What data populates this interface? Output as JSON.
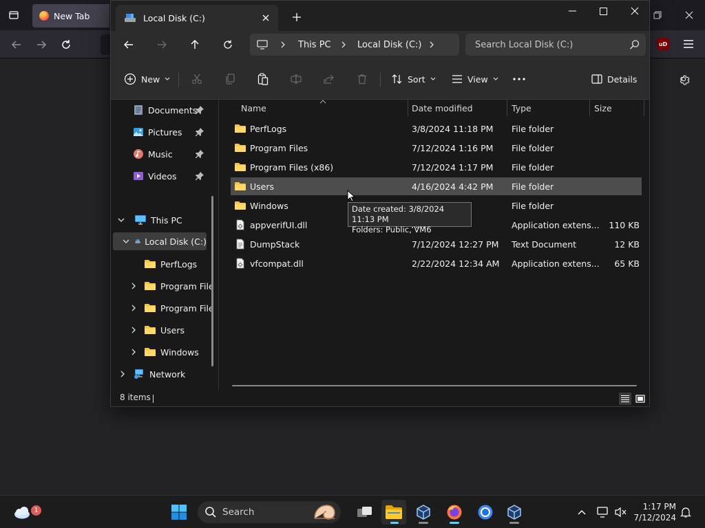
{
  "browser": {
    "tab_title": "New Tab",
    "ext_badge": "uD"
  },
  "explorer": {
    "tab_title": "Local Disk (C:)",
    "breadcrumb": [
      "This PC",
      "Local Disk (C:)"
    ],
    "search_placeholder": "Search Local Disk (C:)",
    "commands": {
      "new": "New",
      "sort": "Sort",
      "view": "View",
      "details": "Details"
    },
    "nav": {
      "quick": [
        {
          "label": "Documents",
          "icon": "documents-icon"
        },
        {
          "label": "Pictures",
          "icon": "pictures-icon"
        },
        {
          "label": "Music",
          "icon": "music-icon"
        },
        {
          "label": "Videos",
          "icon": "videos-icon"
        }
      ],
      "this_pc": "This PC",
      "local_disk": "Local Disk (C:)",
      "children": [
        "PerfLogs",
        "Program File",
        "Program File",
        "Users",
        "Windows"
      ],
      "network": "Network"
    },
    "columns": {
      "name": "Name",
      "date": "Date modified",
      "type": "Type",
      "size": "Size"
    },
    "files": [
      {
        "name": "PerfLogs",
        "date": "3/8/2024 11:18 PM",
        "type": "File folder",
        "size": "",
        "kind": "folder"
      },
      {
        "name": "Program Files",
        "date": "7/12/2024 1:16 PM",
        "type": "File folder",
        "size": "",
        "kind": "folder"
      },
      {
        "name": "Program Files (x86)",
        "date": "7/12/2024 1:17 PM",
        "type": "File folder",
        "size": "",
        "kind": "folder"
      },
      {
        "name": "Users",
        "date": "4/16/2024 4:42 PM",
        "type": "File folder",
        "size": "",
        "kind": "folder"
      },
      {
        "name": "Windows",
        "date": "PM",
        "type": "File folder",
        "size": "",
        "kind": "folder"
      },
      {
        "name": "appverifUI.dll",
        "date": "AM",
        "type": "Application extens...",
        "size": "110 KB",
        "kind": "dll"
      },
      {
        "name": "DumpStack",
        "date": "7/12/2024 12:27 PM",
        "type": "Text Document",
        "size": "12 KB",
        "kind": "txt"
      },
      {
        "name": "vfcompat.dll",
        "date": "2/22/2024 12:34 AM",
        "type": "Application extens...",
        "size": "65 KB",
        "kind": "dll"
      }
    ],
    "tooltip": {
      "line1": "Date created: 3/8/2024 11:13 PM",
      "line2": "Folders: Public, VM6"
    },
    "status": "8 items"
  },
  "taskbar": {
    "search_label": "Search",
    "weather_badge": "1",
    "time": "1:17 PM",
    "date": "7/12/2024"
  },
  "colors": {
    "folder": "#f4c542",
    "accent": "#60cdff",
    "row_hover": "#4d4d4d"
  }
}
